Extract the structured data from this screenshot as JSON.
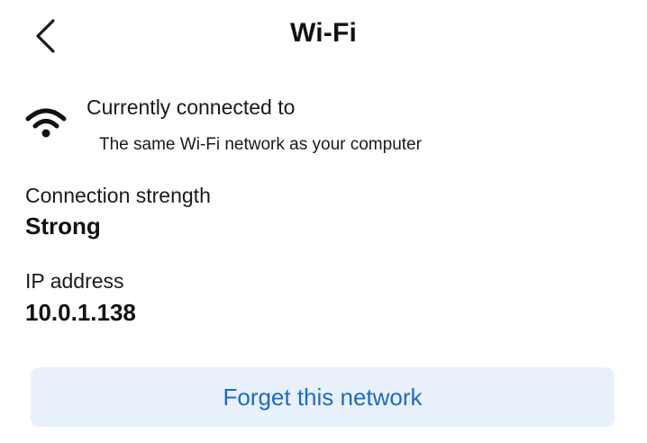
{
  "header": {
    "title": "Wi-Fi",
    "back_icon": "chevron-left-icon"
  },
  "connection": {
    "icon": "wifi-icon",
    "label": "Currently connected to",
    "value": "The same Wi-Fi network as your computer"
  },
  "strength": {
    "label": "Connection strength",
    "value": "Strong"
  },
  "ip": {
    "label": "IP address",
    "value": "10.0.1.138"
  },
  "forget_button": {
    "label": "Forget this network"
  },
  "colors": {
    "accent": "#1e6bc2",
    "button_background": "#e8f1fb",
    "text": "#111111"
  }
}
